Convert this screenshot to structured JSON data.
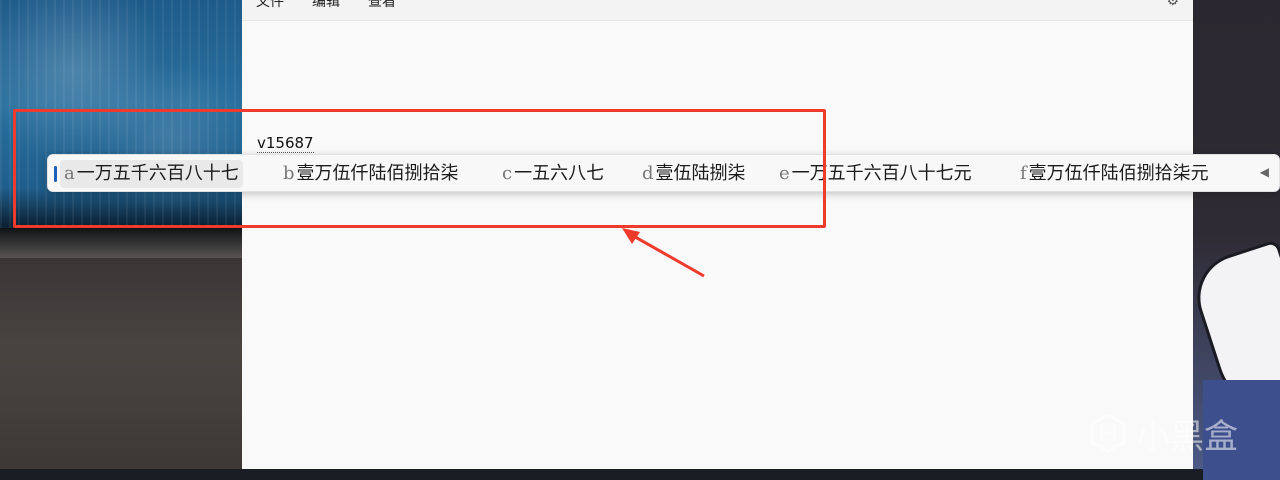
{
  "menu": {
    "file": "文件",
    "edit": "编辑",
    "view": "查看"
  },
  "editor": {
    "text": "v15687"
  },
  "ime": {
    "candidates": [
      {
        "key": "a",
        "text": "一万五千六百八十七",
        "selected": true
      },
      {
        "key": "b",
        "text": "壹万伍仟陆佰捌拾柒",
        "selected": false
      },
      {
        "key": "c",
        "text": "一五六八七",
        "selected": false
      },
      {
        "key": "d",
        "text": "壹伍陆捌柒",
        "selected": false
      },
      {
        "key": "e",
        "text": "一万五千六百八十七元",
        "selected": false
      },
      {
        "key": "f",
        "text": "壹万伍仟陆佰捌拾柒元",
        "selected": false
      }
    ],
    "scroll_icon": "caret-left-icon"
  },
  "watermark": {
    "text": "小黑盒"
  },
  "colors": {
    "annotation": "#ef3b2c",
    "selection_accent": "#1d5fb6"
  },
  "icons": {
    "settings": "gear-icon",
    "watermark_logo": "heybox-logo"
  }
}
